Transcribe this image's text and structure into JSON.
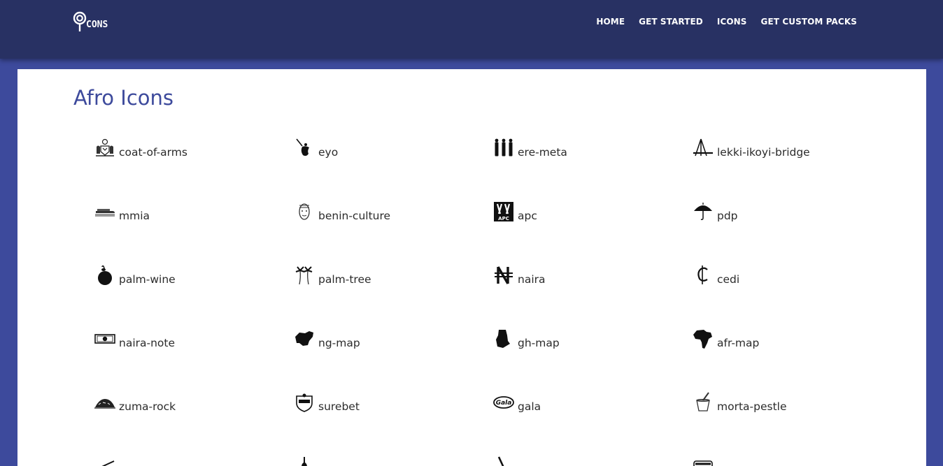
{
  "brand": {
    "logo_text": "CONS",
    "logo_icon": "lollipop-icon"
  },
  "nav": {
    "items": [
      {
        "label": "HOME"
      },
      {
        "label": "GET STARTED"
      },
      {
        "label": "ICONS"
      },
      {
        "label": "GET CUSTOM PACKS"
      }
    ]
  },
  "main": {
    "title": "Afro Icons",
    "icons": [
      {
        "name": "coat-of-arms",
        "icon": "coat-of-arms-icon"
      },
      {
        "name": "eyo",
        "icon": "eyo-icon"
      },
      {
        "name": "ere-meta",
        "icon": "ere-meta-icon"
      },
      {
        "name": "lekki-ikoyi-bridge",
        "icon": "lekki-ikoyi-bridge-icon"
      },
      {
        "name": "mmia",
        "icon": "mmia-icon"
      },
      {
        "name": "benin-culture",
        "icon": "benin-culture-icon"
      },
      {
        "name": "apc",
        "icon": "apc-icon"
      },
      {
        "name": "pdp",
        "icon": "pdp-icon"
      },
      {
        "name": "palm-wine",
        "icon": "palm-wine-icon"
      },
      {
        "name": "palm-tree",
        "icon": "palm-tree-icon"
      },
      {
        "name": "naira",
        "icon": "naira-icon"
      },
      {
        "name": "cedi",
        "icon": "cedi-icon"
      },
      {
        "name": "naira-note",
        "icon": "naira-note-icon"
      },
      {
        "name": "ng-map",
        "icon": "ng-map-icon"
      },
      {
        "name": "gh-map",
        "icon": "gh-map-icon"
      },
      {
        "name": "afr-map",
        "icon": "afr-map-icon"
      },
      {
        "name": "zuma-rock",
        "icon": "zuma-rock-icon"
      },
      {
        "name": "surebet",
        "icon": "surebet-icon"
      },
      {
        "name": "gala",
        "icon": "gala-icon"
      },
      {
        "name": "morta-pestle",
        "icon": "morta-pestle-icon"
      }
    ]
  },
  "colors": {
    "navbar": "#283163",
    "background": "#3d4a9c",
    "title": "#3d4a9c",
    "card": "#ffffff"
  }
}
